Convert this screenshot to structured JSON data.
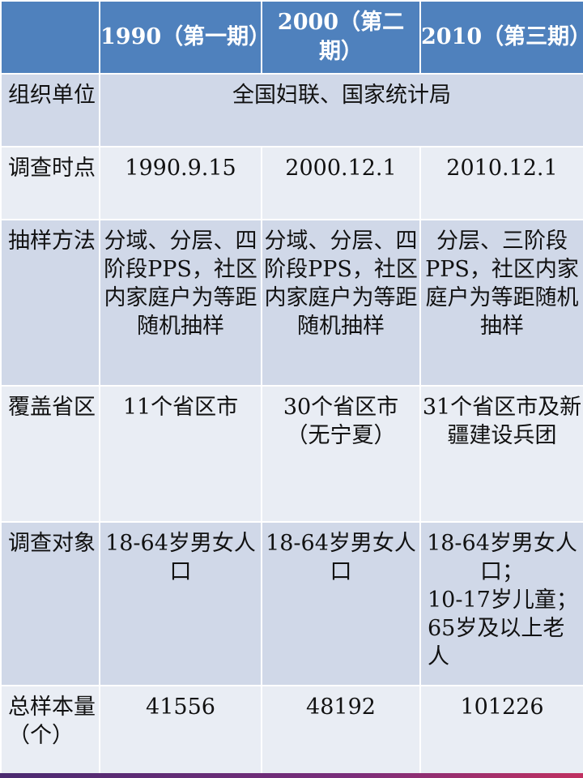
{
  "header": {
    "corner": "",
    "col1": "1990（第一期）",
    "col2": "2000（第二期）",
    "col3": "2010（第三期）"
  },
  "rows": {
    "org": {
      "label": "组织单位",
      "value": "全国妇联、国家统计局"
    },
    "time": {
      "label": "调查时点",
      "c1": "1990.9.15",
      "c2": "2000.12.1",
      "c3": "2010.12.1"
    },
    "method": {
      "label": "抽样方法",
      "c1": "分域、分层、四阶段PPS，社区内家庭户为等距随机抽样",
      "c2": "分域、分层、四阶段PPS，社区内家庭户为等距随机抽样",
      "c3": "分层、三阶段PPS，社区内家庭户为等距随机抽样"
    },
    "coverage": {
      "label": "覆盖省区",
      "c1": "11个省区市",
      "c2": "30个省区市（无宁夏）",
      "c3": "31个省区市及新疆建设兵团"
    },
    "subject": {
      "label": "调查对象",
      "c1": "18-64岁男女人口",
      "c2": "18-64岁男女人口",
      "c3_line1": "18-64岁男女人口；",
      "c3_line2": "10-17岁儿童；",
      "c3_line3": "65岁及以上老人"
    },
    "sample": {
      "label": "总样本量（个）",
      "c1": "41556",
      "c2": "48192",
      "c3": "101226"
    }
  }
}
